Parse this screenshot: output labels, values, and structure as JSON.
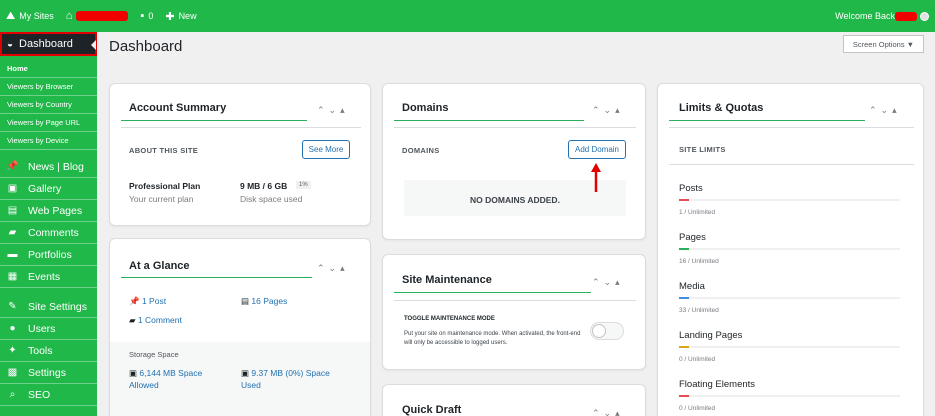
{
  "topbar": {
    "my_sites": "My Sites",
    "comments_count": "0",
    "new_label": "New",
    "welcome": "Welcome Back"
  },
  "sidebar": {
    "dashboard": "Dashboard",
    "subitems": [
      "Home",
      "Viewers by Browser",
      "Viewers by Country",
      "Viewers by Page URL",
      "Viewers by Device"
    ],
    "items": [
      {
        "label": "News | Blog",
        "icon": "pin-icon"
      },
      {
        "label": "Gallery",
        "icon": "gallery-icon"
      },
      {
        "label": "Web Pages",
        "icon": "pages-icon"
      },
      {
        "label": "Comments",
        "icon": "comment-icon"
      },
      {
        "label": "Portfolios",
        "icon": "folder-icon"
      },
      {
        "label": "Events",
        "icon": "calendar-icon"
      },
      {
        "label": "Site Settings",
        "icon": "wrench-icon"
      },
      {
        "label": "Users",
        "icon": "user-icon"
      },
      {
        "label": "Tools",
        "icon": "tools-icon"
      },
      {
        "label": "Settings",
        "icon": "settings-icon"
      },
      {
        "label": "SEO",
        "icon": "search-icon"
      }
    ]
  },
  "header": {
    "title": "Dashboard",
    "screen_options": "Screen Options ▼"
  },
  "account": {
    "title": "Account Summary",
    "section": "ABOUT THIS SITE",
    "see_more": "See More",
    "plan": "Professional Plan",
    "plan_sub": "Your current plan",
    "disk": "9 MB / 6 GB",
    "disk_pct": "1%",
    "disk_sub": "Disk space used"
  },
  "glance": {
    "title": "At a Glance",
    "posts": "1 Post",
    "pages": "16 Pages",
    "comments": "1 Comment",
    "storage_label": "Storage Space",
    "allowed": "6,144 MB Space Allowed",
    "used": "9.37 MB (0%) Space Used"
  },
  "domains": {
    "title": "Domains",
    "section": "DOMAINS",
    "add": "Add Domain",
    "empty": "NO DOMAINS ADDED."
  },
  "maintenance": {
    "title": "Site Maintenance",
    "section": "TOGGLE MAINTENANCE MODE",
    "desc": "Put your site on maintenance mode. When activated, the front-end will only be accessible to logged users."
  },
  "draft": {
    "title": "Quick Draft"
  },
  "limits": {
    "title": "Limits & Quotas",
    "section": "SITE LIMITS",
    "items": [
      {
        "label": "Posts",
        "value": "1 / Unlimited",
        "color": "#e65054"
      },
      {
        "label": "Pages",
        "value": "16 / Unlimited",
        "color": "#2ab05c"
      },
      {
        "label": "Media",
        "value": "33 / Unlimited",
        "color": "#3c8fe0"
      },
      {
        "label": "Landing Pages",
        "value": "0 / Unlimited",
        "color": "#dba617"
      },
      {
        "label": "Floating Elements",
        "value": "0 / Unlimited",
        "color": "#e65054"
      }
    ]
  },
  "colors": {
    "brand": "#21b84a",
    "accent": "#2271b1",
    "arrow": "#e00000"
  }
}
